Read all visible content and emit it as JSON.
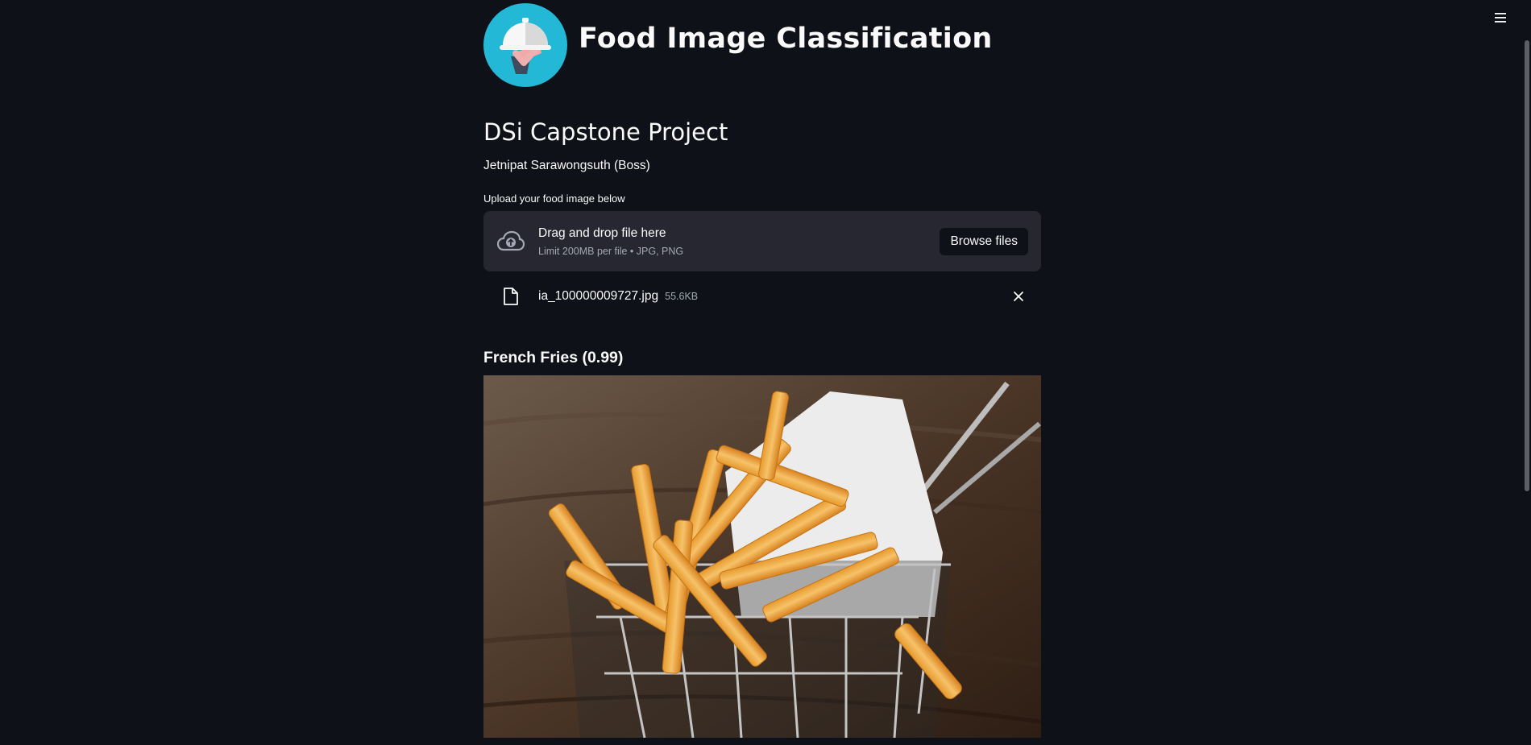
{
  "header": {
    "title": "Food Image Classification",
    "logo_icon": "food-cloche-icon"
  },
  "project": {
    "title": "DSi Capstone Project",
    "author": "Jetnipat Sarawongsuth (Boss)"
  },
  "uploader": {
    "label": "Upload your food image below",
    "drop_title": "Drag and drop file here",
    "drop_limit": "Limit 200MB per file • JPG, PNG",
    "browse_label": "Browse files"
  },
  "uploaded_file": {
    "name": "ia_100000009727.jpg",
    "size": "55.6KB"
  },
  "result": {
    "prediction": "French Fries (0.99)"
  },
  "theme": {
    "background": "#0e1117",
    "surface": "#262730",
    "text": "#fafafa",
    "muted_text": "#a3a8b4",
    "logo_bg": "#22b8d6"
  }
}
